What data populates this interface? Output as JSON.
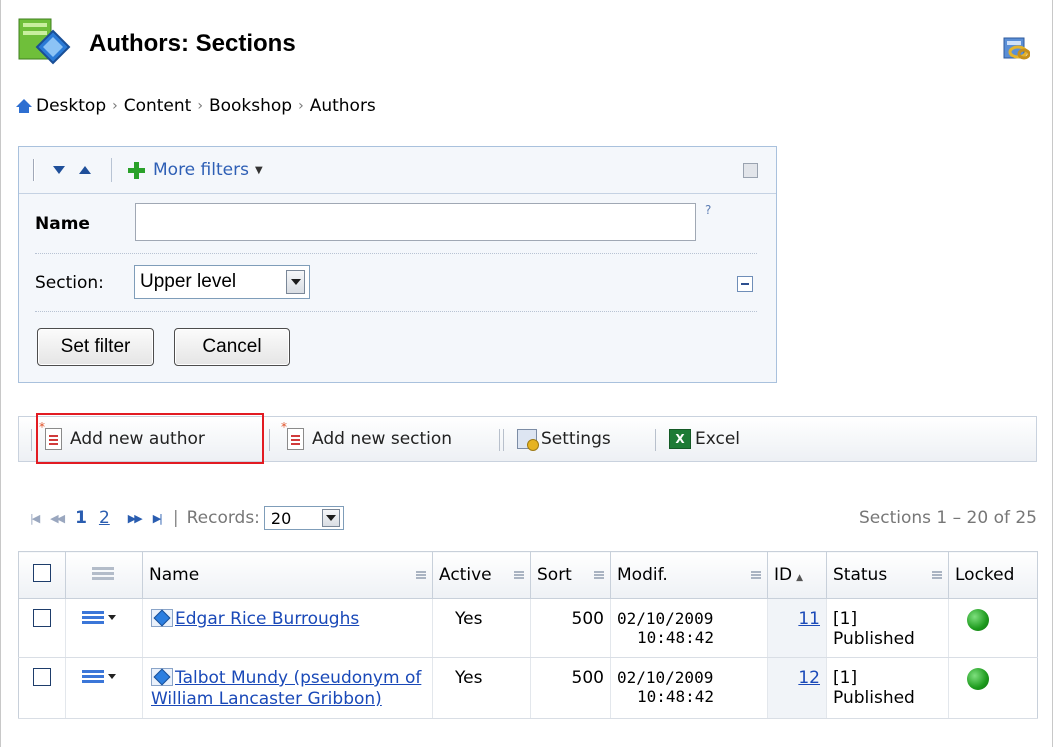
{
  "header": {
    "title": "Authors: Sections"
  },
  "breadcrumb": {
    "items": [
      "Desktop",
      "Content",
      "Bookshop",
      "Authors"
    ],
    "separator": "›"
  },
  "filter": {
    "more_filters": "More filters",
    "name_label": "Name",
    "name_value": "",
    "help": "?",
    "section_label": "Section:",
    "section_value": "Upper level",
    "set_filter": "Set filter",
    "cancel": "Cancel"
  },
  "toolbar": {
    "add_author": "Add new author",
    "add_section": "Add new section",
    "settings": "Settings",
    "excel": "Excel",
    "excel_icon_glyph": "X"
  },
  "pager": {
    "current_page": "1",
    "page_2": "2",
    "records_label": "Records:",
    "records_value": "20",
    "info": "Sections 1 – 20 of 25"
  },
  "table": {
    "columns": [
      "Name",
      "Active",
      "Sort",
      "Modif.",
      "ID",
      "Status",
      "Locked"
    ],
    "rows": [
      {
        "name": "Edgar Rice Burroughs",
        "active": "Yes",
        "sort": "500",
        "modif_date": "02/10/2009",
        "modif_time": "10:48:42",
        "id": "11",
        "status_code": "[1]",
        "status_text": "Published",
        "locked_color": "#1d9a1d"
      },
      {
        "name": "Talbot Mundy (pseudonym of William Lancaster Gribbon)",
        "active": "Yes",
        "sort": "500",
        "modif_date": "02/10/2009",
        "modif_time": "10:48:42",
        "id": "12",
        "status_code": "[1]",
        "status_text": "Published",
        "locked_color": "#1d9a1d"
      }
    ]
  },
  "colors": {
    "highlight": "#e21b22",
    "link": "#1a49b8",
    "accent_green": "#2aa12a"
  }
}
